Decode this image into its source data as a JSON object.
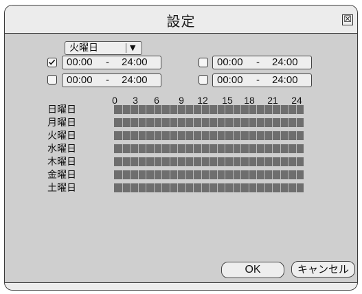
{
  "dialog": {
    "title": "設定",
    "close_glyph": "☒"
  },
  "day_select": {
    "value": "火曜日",
    "arrow": "▼"
  },
  "time_ranges": [
    {
      "checked": true,
      "start": "00:00",
      "dash": "-",
      "end": "24:00"
    },
    {
      "checked": false,
      "start": "00:00",
      "dash": "-",
      "end": "24:00"
    },
    {
      "checked": false,
      "start": "00:00",
      "dash": "-",
      "end": "24:00"
    },
    {
      "checked": false,
      "start": "00:00",
      "dash": "-",
      "end": "24:00"
    }
  ],
  "schedule": {
    "hour_labels": [
      "0",
      "3",
      "6",
      "9",
      "12",
      "15",
      "18",
      "21",
      "24"
    ],
    "days": [
      "日曜日",
      "月曜日",
      "火曜日",
      "水曜日",
      "木曜日",
      "金曜日",
      "土曜日"
    ],
    "active_color": "#6e6e6e"
  },
  "buttons": {
    "ok": "OK",
    "cancel": "キャンセル"
  }
}
